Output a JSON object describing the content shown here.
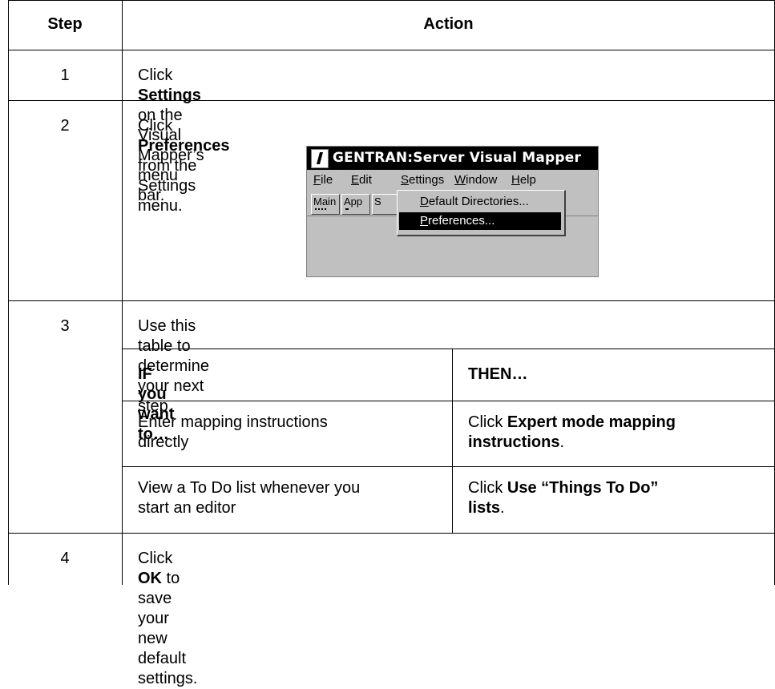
{
  "table": {
    "headers": {
      "step": "Step",
      "action": "Action"
    },
    "rows": [
      {
        "step": "1",
        "pre": "Click ",
        "bold": "Settings",
        "post": " on the Visual Mapper’s menu bar."
      },
      {
        "step": "2",
        "pre": "Click ",
        "bold": "Preferences",
        "post": " from the Settings menu."
      },
      {
        "step": "3",
        "text": "Use this table to determine your next step."
      },
      {
        "step": "4",
        "pre": "Click ",
        "bold": "OK",
        "post": " to save your new default settings."
      }
    ]
  },
  "inner_table": {
    "headers": {
      "if": "IF you want to…",
      "then": "THEN…"
    },
    "rows": [
      {
        "if_l1": "Enter mapping instructions",
        "if_l2": "directly",
        "then_pre": "Click ",
        "then_bold_l1": "Expert mode mapping",
        "then_bold_l2": "instructions",
        "then_post": "."
      },
      {
        "if_l1": "View a To Do list whenever you",
        "if_l2": "start an editor",
        "then_pre": "Click ",
        "then_bold_l1": "Use “Things To Do”",
        "then_bold_l2": "lists",
        "then_post": "."
      }
    ]
  },
  "screenshot": {
    "title": "GENTRAN:Server Visual Mapper",
    "menus": [
      {
        "accel": "F",
        "rest": "ile"
      },
      {
        "accel": "E",
        "rest": "dit"
      },
      {
        "accel": "S",
        "rest": "ettings"
      },
      {
        "accel": "W",
        "rest": "indow"
      },
      {
        "accel": "H",
        "rest": "elp"
      }
    ],
    "toolbar": [
      "Main",
      "App",
      "S"
    ],
    "dropdown": [
      {
        "accel": "D",
        "rest": "efault Directories..."
      },
      {
        "accel": "P",
        "rest": "references..."
      }
    ],
    "selected_item": "Preferences..."
  }
}
